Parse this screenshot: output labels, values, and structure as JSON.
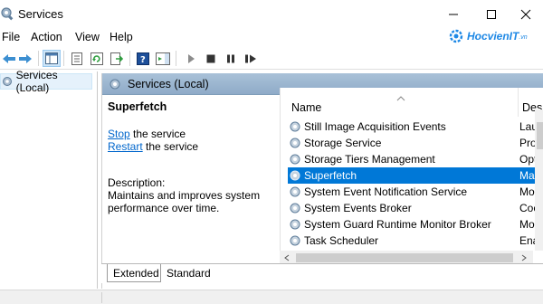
{
  "window": {
    "title": "Services",
    "icon": "services-gear-icon",
    "controls": {
      "minimize_icon": "minimize-icon",
      "maximize_icon": "maximize-icon",
      "close_icon": "close-icon"
    }
  },
  "menu": {
    "items": [
      "File",
      "Action",
      "View",
      "Help"
    ]
  },
  "brand": {
    "name": "HocvienIT",
    "suffix": ".vn",
    "color": "#1e88e5"
  },
  "toolbar": {
    "icons": [
      "back-icon",
      "forward-icon",
      "show-hide-tree-icon",
      "properties-icon",
      "refresh-icon",
      "export-list-icon",
      "help-icon",
      "show-action-pane-icon",
      "start-icon",
      "stop-icon",
      "pause-icon",
      "restart-icon"
    ]
  },
  "tree": {
    "selected": "Services (Local)"
  },
  "content": {
    "header": "Services (Local)",
    "service_name": "Superfetch",
    "stop_link": "Stop",
    "stop_text": " the service",
    "restart_link": "Restart",
    "restart_text": " the service",
    "description_label": "Description:",
    "description": "Maintains and improves system performance over time."
  },
  "list": {
    "columns": {
      "name": "Name",
      "description": "Des"
    },
    "rows": [
      {
        "name": "Still Image Acquisition Events",
        "desc": "Lau"
      },
      {
        "name": "Storage Service",
        "desc": "Pro"
      },
      {
        "name": "Storage Tiers Management",
        "desc": "Opt"
      },
      {
        "name": "Superfetch",
        "desc": "Ma",
        "selected": true
      },
      {
        "name": "System Event Notification Service",
        "desc": "Mo"
      },
      {
        "name": "System Events Broker",
        "desc": "Coc"
      },
      {
        "name": "System Guard Runtime Monitor Broker",
        "desc": "Mo"
      },
      {
        "name": "Task Scheduler",
        "desc": "Ena"
      }
    ]
  },
  "tabs": {
    "extended": "Extended",
    "standard": "Standard"
  },
  "colors": {
    "selection": "#0078d7",
    "header_bar": "#9bb5d0",
    "link": "#0066cc"
  }
}
